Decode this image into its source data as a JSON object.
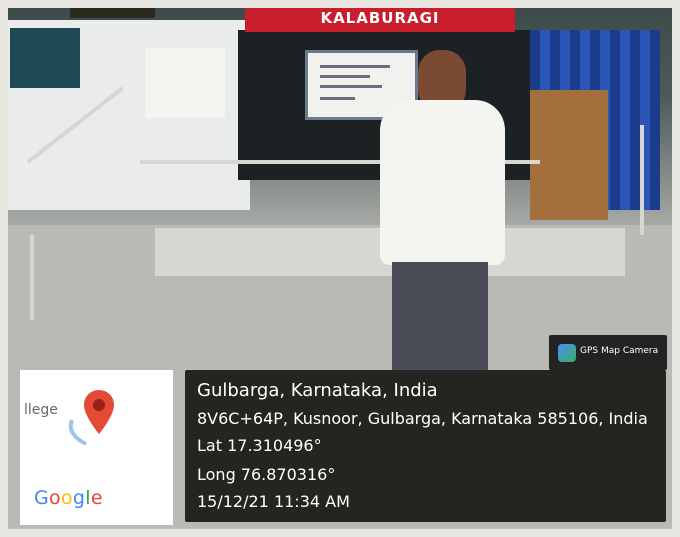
{
  "banner": {
    "text": "KALABURAGI"
  },
  "gps_badge": {
    "label": "GPS Map Camera",
    "icon": "gps-map-camera-icon"
  },
  "map_thumbnail": {
    "partial_label": "llege",
    "provider": "Google",
    "pin_icon": "map-pin-icon",
    "provider_colors": [
      "#4285F4",
      "#EA4335",
      "#FBBC05",
      "#4285F4",
      "#34A853",
      "#EA4335"
    ]
  },
  "location": {
    "place": "Gulbarga, Karnataka, India",
    "address": "8V6C+64P, Kusnoor, Gulbarga, Karnataka 585106, India",
    "latitude": "Lat 17.310496°",
    "longitude": "Long 76.870316°",
    "timestamp": "15/12/21 11:34 AM"
  },
  "colors": {
    "overlay": "#252420",
    "banner": "#c81d2a",
    "pin": "#e44a36"
  }
}
